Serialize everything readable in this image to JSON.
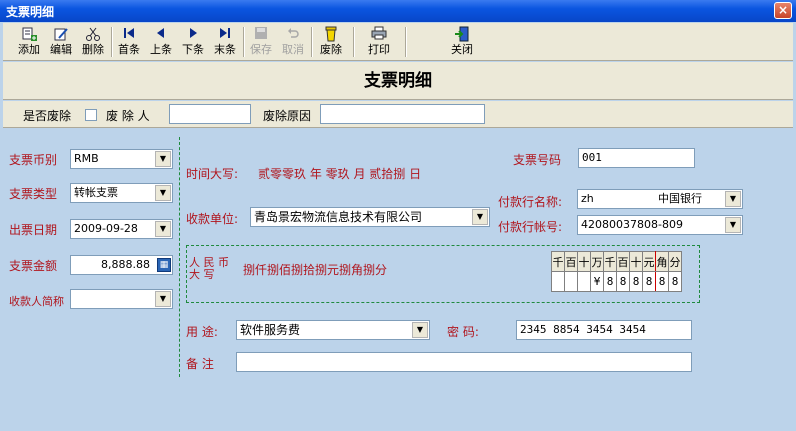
{
  "window": {
    "title": "支票明细",
    "close_glyph": "×"
  },
  "toolbar": {
    "add": "添加",
    "edit": "编辑",
    "delete": "删除",
    "first": "首条",
    "prev": "上条",
    "next": "下条",
    "last": "末条",
    "save": "保存",
    "cancel": "取消",
    "scrap": "废除",
    "print": "打印",
    "close": "关闭"
  },
  "heading": "支票明细",
  "scrap": {
    "is_scrapped_label": "是否废除",
    "scrapper_label": "废 除 人",
    "scrapper_value": "",
    "reason_label": "废除原因",
    "reason_value": ""
  },
  "form": {
    "currency_label": "支票币别",
    "currency_value": "RMB",
    "type_label": "支票类型",
    "type_value": "转帐支票",
    "date_label": "出票日期",
    "date_value": "2009-09-28",
    "amount_label": "支票金额",
    "amount_value": "8,888.88",
    "payee_short_label": "收款人简称",
    "payee_short_value": "",
    "time_caps_label": "时间大写:",
    "time_caps_value": "贰零零玖  年  零玖  月  贰拾捌  日",
    "check_no_label": "支票号码",
    "check_no_value": "001",
    "payee_label": "收款单位:",
    "payee_value": "青岛景宏物流信息技术有限公司",
    "bank_name_label": "付款行名称:",
    "bank_code": "zh",
    "bank_name": "中国银行",
    "bank_account_label": "付款行帐号:",
    "bank_account_value": "42080037808-809",
    "rmb_caps_1": "人 民 币",
    "rmb_caps_2": "大       写",
    "amount_caps_value": "捌仟捌佰捌拾捌元捌角捌分",
    "digit_headers": [
      "千",
      "百",
      "十",
      "万",
      "千",
      "百",
      "十",
      "元",
      "角",
      "分"
    ],
    "digit_values": [
      "",
      "",
      "",
      "¥",
      "8",
      "8",
      "8",
      "8",
      "8",
      "8"
    ],
    "usage_label": "用   途:",
    "usage_value": "软件服务费",
    "password_label": "密      码:",
    "password_value": "2345 8854 3454 3454",
    "note_label": "备 注",
    "note_value": ""
  },
  "icons": {
    "calculator": "calculator-icon"
  }
}
